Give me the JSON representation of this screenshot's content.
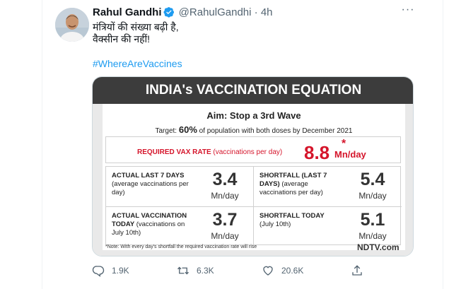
{
  "tweet": {
    "author_name": "Rahul Gandhi",
    "handle": "@RahulGandhi",
    "separator": "·",
    "time": "4h",
    "more_label": "···",
    "text_line1": "मंत्रियों की संख्या बढ़ी है,",
    "text_line2": "वैक्सीन की नहीं!",
    "hashtag": "#WhereAreVaccines"
  },
  "card": {
    "title": "INDIA's VACCINATION EQUATION",
    "aim": "Aim: Stop a 3rd Wave",
    "target_prefix": "Target: ",
    "target_pct": "60%",
    "target_suffix": " of population with both doses by December 2021",
    "required_label": "REQUIRED VAX RATE",
    "required_sub": " (vaccinations per day)",
    "required_value": "8.8",
    "required_star": "*",
    "required_unit": "Mn/day",
    "cells": [
      {
        "label": "ACTUAL LAST 7 DAYS",
        "sub": "(average vaccinations per day)",
        "value": "3.4",
        "unit": "Mn/day"
      },
      {
        "label": "SHORTFALL (LAST 7 DAYS)",
        "sub": "(average vaccinations per day)",
        "value": "5.4",
        "unit": "Mn/day"
      },
      {
        "label": "ACTUAL VACCINATION TODAY",
        "sub": "(vaccinations on July 10th)",
        "value": "3.7",
        "unit": "Mn/day"
      },
      {
        "label": "SHORTFALL TODAY",
        "sub": "(July 10th)",
        "value": "5.1",
        "unit": "Mn/day"
      }
    ],
    "note": "*Note: With every day's shortfall the required vaccination rate will rise",
    "brand": "NDTV.com"
  },
  "actions": {
    "replies": "1.9K",
    "retweets": "6.3K",
    "likes": "20.6K"
  },
  "colors": {
    "link": "#1d9bf0",
    "secondary_text": "#536471",
    "card_header_bg": "#3c3c3c",
    "accent_red": "#d5152b",
    "verified_blue": "#1d9bf0"
  },
  "icons": {
    "verified": "verified-badge-icon",
    "more": "more-horizontal-icon",
    "reply": "reply-icon",
    "retweet": "retweet-icon",
    "like": "heart-icon",
    "share": "share-icon"
  }
}
